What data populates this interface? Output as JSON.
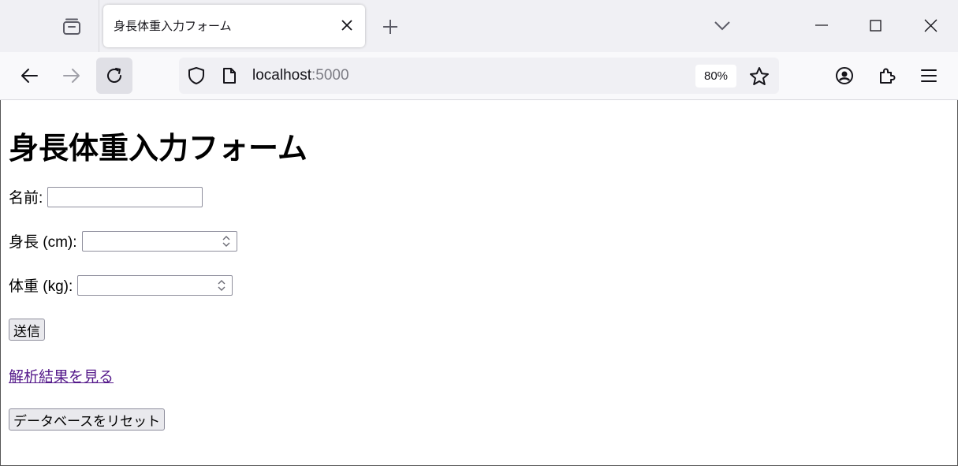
{
  "browser": {
    "tab": {
      "title": "身長体重入力フォーム"
    },
    "url": {
      "host": "localhost",
      "port": ":5000"
    },
    "zoom": "80%"
  },
  "page": {
    "heading": "身長体重入力フォーム",
    "form": {
      "name_label": "名前:",
      "name_value": "",
      "height_label": "身長 (cm):",
      "height_value": "",
      "weight_label": "体重 (kg):",
      "weight_value": "",
      "submit_label": "送信"
    },
    "results_link": "解析結果を見る",
    "reset_button": "データベースをリセット"
  },
  "colors": {
    "tabstrip_bg": "#f0f0f4",
    "toolbar_bg": "#f9f9fb",
    "link_visited": "#551a8b"
  }
}
